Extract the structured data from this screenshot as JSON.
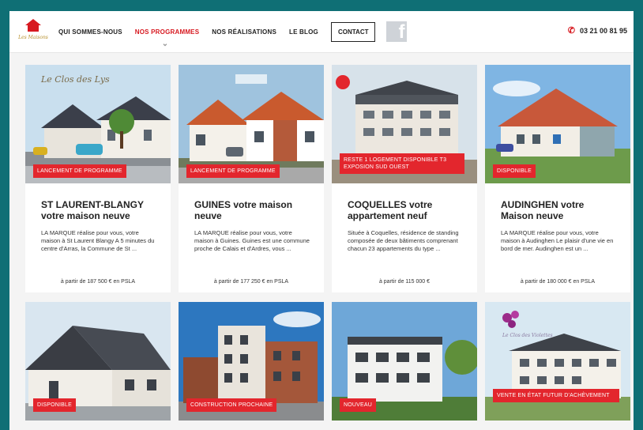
{
  "nav": {
    "items": [
      {
        "label": "QUI SOMMES-NOUS",
        "active": false
      },
      {
        "label": "NOS PROGRAMMES",
        "active": true
      },
      {
        "label": "NOS RÉALISATIONS",
        "active": false
      },
      {
        "label": "LE BLOG",
        "active": false
      }
    ],
    "contact_label": "CONTACT",
    "facebook_glyph": "f",
    "phone": "03 21 00 81 95",
    "accent_color": "#d71920"
  },
  "logo": {
    "text": "Les Maisons"
  },
  "programs": [
    {
      "image_text": "Le Clos des Lys",
      "badge": "LANCEMENT DE PROGRAMME",
      "title": "ST LAURENT-BLANGY votre maison neuve",
      "description": "LA MARQUE réalise pour vous, votre maison à St Laurent Blangy A 5 minutes du centre d'Arras, la Commune de St ...",
      "price": "à partir de 187 500 € en PSLA"
    },
    {
      "image_text": "",
      "badge": "LANCEMENT DE PROGRAMME",
      "title": "GUINES votre maison neuve",
      "description": "LA MARQUE réalise pour vous, votre maison à Guines. Guines est une commune proche de Calais et d'Ardres, vous ...",
      "price": "à partir de 177 250 € en PSLA"
    },
    {
      "image_text": "",
      "badge": "RESTE 1 LOGEMENT DISPONIBLE T3 EXPOSION SUD OUEST",
      "title": "COQUELLES votre appartement neuf",
      "description": "Située à Coquelles, résidence de standing composée de deux bâtiments comprenant chacun 23 appartements du type ...",
      "price": "à partir de 115 000 €"
    },
    {
      "image_text": "",
      "badge": "DISPONIBLE",
      "title": "AUDINGHEN votre Maison neuve",
      "description": "LA MARQUE réalise pour vous, votre maison à Audinghen Le plaisir d'une vie en bord de mer. Audinghen est un ...",
      "price": "à partir de 180 000 € en PSLA"
    },
    {
      "image_text": "",
      "badge": "DISPONIBLE"
    },
    {
      "image_text": "",
      "badge": "CONSTRUCTION PROCHAINE"
    },
    {
      "image_text": "",
      "badge": "NOUVEAU"
    },
    {
      "image_text": "Le Clos des Violettes",
      "badge": "VENTE EN ÉTAT FUTUR D'ACHÈVEMENT"
    }
  ],
  "colors": {
    "teal_frame": "#0f6f75",
    "badge_red": "#e3262d",
    "page_bg": "#f4f4f4"
  }
}
